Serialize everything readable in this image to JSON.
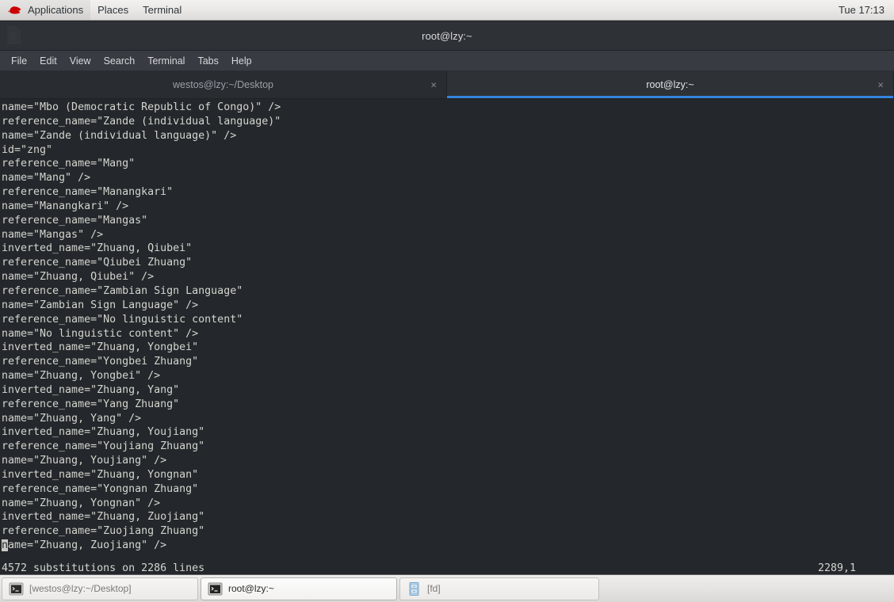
{
  "desktop": {
    "panel": {
      "logo_icon": "redhat-logo-icon",
      "menus": [
        "Applications",
        "Places",
        "Terminal"
      ],
      "clock": "Tue 17:13"
    }
  },
  "window": {
    "title": "root@lzy:~",
    "title_icon": "document-icon",
    "menubar": [
      "File",
      "Edit",
      "View",
      "Search",
      "Terminal",
      "Tabs",
      "Help"
    ],
    "tabs": [
      {
        "label": "westos@lzy:~/Desktop",
        "active": false,
        "close": "×"
      },
      {
        "label": "root@lzy:~",
        "active": true,
        "close": "×"
      }
    ]
  },
  "terminal": {
    "lines": [
      "name=\"Mbo (Democratic Republic of Congo)\" />",
      "reference_name=\"Zande (individual language)\"",
      "name=\"Zande (individual language)\" />",
      "id=\"zng\"",
      "reference_name=\"Mang\"",
      "name=\"Mang\" />",
      "reference_name=\"Manangkari\"",
      "name=\"Manangkari\" />",
      "reference_name=\"Mangas\"",
      "name=\"Mangas\" />",
      "inverted_name=\"Zhuang, Qiubei\"",
      "reference_name=\"Qiubei Zhuang\"",
      "name=\"Zhuang, Qiubei\" />",
      "reference_name=\"Zambian Sign Language\"",
      "name=\"Zambian Sign Language\" />",
      "reference_name=\"No linguistic content\"",
      "name=\"No linguistic content\" />",
      "inverted_name=\"Zhuang, Yongbei\"",
      "reference_name=\"Yongbei Zhuang\"",
      "name=\"Zhuang, Yongbei\" />",
      "inverted_name=\"Zhuang, Yang\"",
      "reference_name=\"Yang Zhuang\"",
      "name=\"Zhuang, Yang\" />",
      "inverted_name=\"Zhuang, Youjiang\"",
      "reference_name=\"Youjiang Zhuang\"",
      "name=\"Zhuang, Youjiang\" />",
      "inverted_name=\"Zhuang, Yongnan\"",
      "reference_name=\"Yongnan Zhuang\"",
      "name=\"Zhuang, Yongnan\" />",
      "inverted_name=\"Zhuang, Zuojiang\"",
      "reference_name=\"Zuojiang Zhuang\""
    ],
    "cursor_line": {
      "cursor_char": "n",
      "rest": "ame=\"Zhuang, Zuojiang\" />"
    },
    "status_left": "4572 substitutions on 2286 lines",
    "status_right": "2289,1"
  },
  "taskbar": {
    "items": [
      {
        "label": "[westos@lzy:~/Desktop]",
        "icon": "terminal-icon",
        "active": false
      },
      {
        "label": "root@lzy:~",
        "icon": "terminal-icon",
        "active": true
      },
      {
        "label": "[fd]",
        "icon": "file-cabinet-icon",
        "active": false
      }
    ]
  },
  "colors": {
    "accent_blue": "#3584e0",
    "terminal_bg": "#24272b",
    "terminal_fg": "#d3d7cf",
    "redhat_red": "#cc0000"
  }
}
